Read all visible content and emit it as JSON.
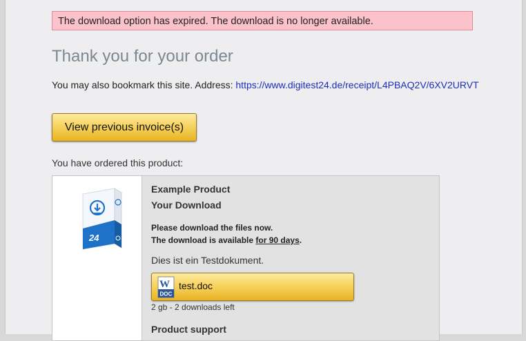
{
  "alert": {
    "text": "The download option has expired. The download is no longer available."
  },
  "heading": {
    "title": "Thank you for your order"
  },
  "bookmark": {
    "prefix": "You may also bookmark this site. Address:",
    "url": "https://www.digitest24.de/receipt/L4PBAQ2V/6XV2URVT"
  },
  "buttons": {
    "invoice_label": "View previous invoice(s)"
  },
  "order": {
    "intro": "You have ordered this product:",
    "product_name": "Example Product",
    "download_heading": "Your Download",
    "instruction_line1": "Please download the files now.",
    "instruction_line2_prefix": "The download is available",
    "instruction_line2_duration": "for 90 days",
    "instruction_line2_suffix": ".",
    "document_note": "Dies ist ein Testdokument.",
    "file": {
      "name": "test.doc",
      "icon": "word-doc-icon",
      "icon_text": "DOC",
      "meta": "2 gb - 2 downloads left"
    },
    "support_heading": "Product support"
  },
  "colors": {
    "alert_bg": "#fbc2cb",
    "title": "#7d8791",
    "link": "#1a2fb5",
    "button_gold": "#f7d460",
    "product_brand_blue": "#1e72c8"
  }
}
